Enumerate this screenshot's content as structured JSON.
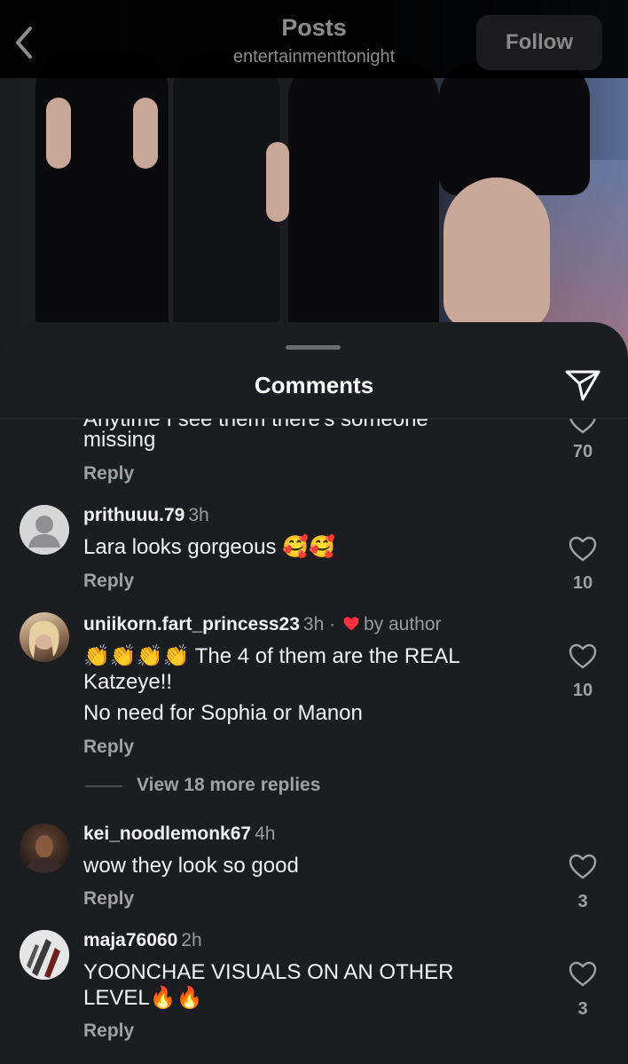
{
  "header": {
    "title": "Posts",
    "subtitle": "entertainmenttonight",
    "follow_label": "Follow",
    "back_icon": "chevron-left-icon"
  },
  "sheet": {
    "title": "Comments",
    "share_icon": "paper-plane-icon"
  },
  "partial_comment": {
    "text_line1": "Anytime I see them there's someone",
    "text_line2": "missing",
    "reply_label": "Reply",
    "likes": "70"
  },
  "comments": [
    {
      "username": "prithuuu.79",
      "time": "3h",
      "text": "Lara looks gorgeous 🥰🥰",
      "reply_label": "Reply",
      "likes": "10",
      "avatar": "default-avatar"
    },
    {
      "username": "uniikorn.fart_princess23",
      "time": "3h",
      "separator": "·",
      "author_badge": "by author",
      "text": "👏👏👏👏 The 4 of them are the REAL Katzeye!!",
      "text_line2": "No need for Sophia or Manon",
      "reply_label": "Reply",
      "likes": "10",
      "view_replies": "View 18 more replies"
    },
    {
      "username": "kei_noodlemonk67",
      "time": "4h",
      "text": "wow they look so good",
      "reply_label": "Reply",
      "likes": "3"
    },
    {
      "username": "maja76060",
      "time": "2h",
      "text": "YOONCHAE VISUALS ON AN OTHER LEVEL🔥🔥",
      "reply_label": "Reply",
      "likes": "3"
    }
  ],
  "colors": {
    "sheet_bg": "#1c1d21",
    "author_heart": "#ff3040",
    "muted": "#a0a0a5"
  }
}
